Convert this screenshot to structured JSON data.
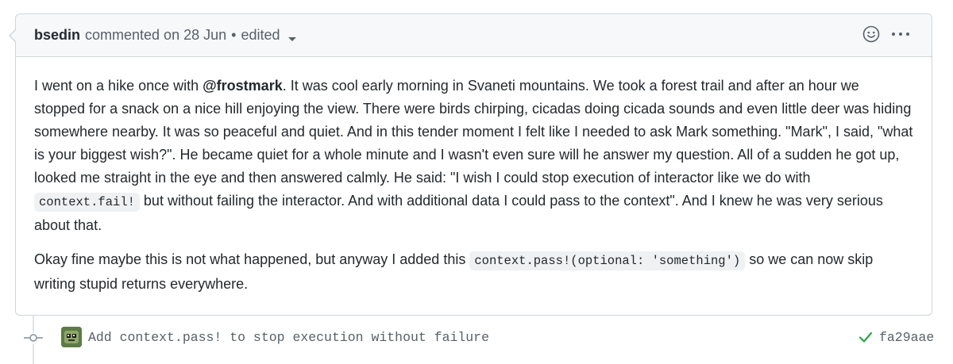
{
  "comment": {
    "author": "bsedin",
    "action": "commented on",
    "date": "28 Jun",
    "separator": "•",
    "edited_label": "edited",
    "icons": {
      "reaction": "smiley-icon",
      "options": "kebab-icon",
      "edited_menu": "caret-down-icon"
    },
    "paragraph1": {
      "before_mention": "I went on a hike once with ",
      "mention": "@frostmark",
      "after_mention": ". It was cool early morning in Svaneti mountains. We took a forest trail and after an hour we stopped for a snack on a nice hill enjoying the view. There were birds chirping, cicadas doing cicada sounds and even little deer was hiding somewhere nearby. It was so peaceful and quiet. And in this tender moment I felt like I needed to ask Mark something. \"Mark\", I said, \"what is your biggest wish?\". He became quiet for a whole minute and I wasn't even sure will he answer my question. All of a sudden he got up, looked me straight in the eye and then answered calmly. He said: \"I wish I could stop execution of interactor like we do with ",
      "code": "context.fail!",
      "after_code": " but without failing the interactor. And with additional data I could pass to the context\". And I knew he was very serious about that."
    },
    "paragraph2": {
      "before_code": "Okay fine maybe this is not what happened, but anyway I added this ",
      "code": "context.pass!(optional: 'something')",
      "after_code": " so we can now skip writing stupid returns everywhere."
    }
  },
  "commit": {
    "message": "Add context.pass! to stop execution without failure",
    "sha": "fa29aae",
    "status": "success",
    "colors": {
      "success": "#28a745"
    },
    "icons": {
      "node": "git-commit-icon",
      "status": "check-icon",
      "avatar": "avatar"
    }
  }
}
